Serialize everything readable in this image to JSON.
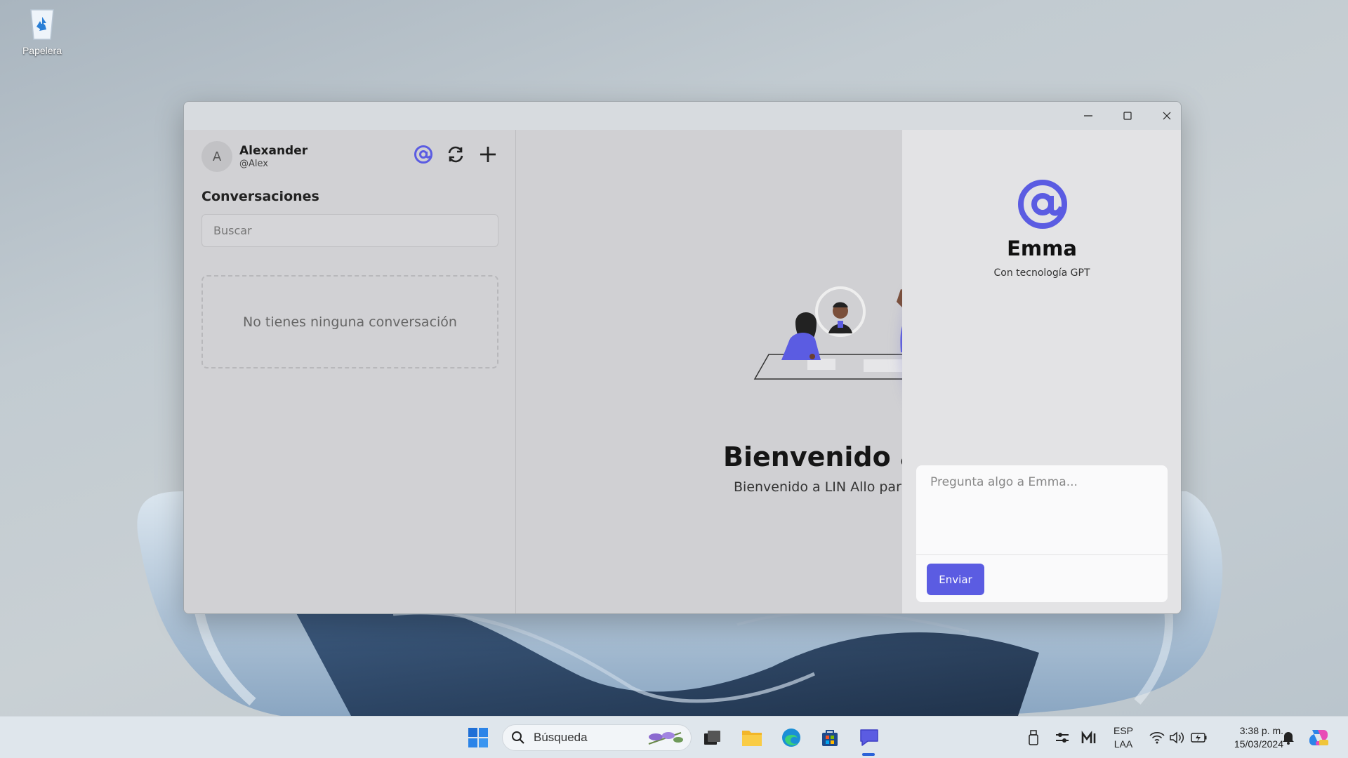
{
  "desktop": {
    "recycle_bin_label": "Papelera"
  },
  "window": {
    "controls": {
      "minimize": "minimize",
      "maximize": "maximize",
      "close": "close"
    }
  },
  "sidebar": {
    "avatar_initial": "A",
    "user_name": "Alexander",
    "user_handle": "@Alex",
    "icons": [
      "at-icon",
      "refresh-icon",
      "plus-icon"
    ],
    "section_title": "Conversaciones",
    "search_placeholder": "Buscar",
    "empty_message": "No tienes ninguna conversación"
  },
  "main": {
    "welcome_title": "Bienvenido a L",
    "welcome_subtitle": "Bienvenido a LIN Allo para"
  },
  "emma_panel": {
    "name": "Emma",
    "subtitle": "Con tecnología GPT",
    "input_placeholder": "Pregunta algo a Emma...",
    "send_label": "Enviar",
    "accent_color": "#5b5ce2"
  },
  "taskbar": {
    "search_placeholder": "Búsqueda",
    "language": "ESP",
    "layout": "LAA",
    "time": "3:38 p. m.",
    "date": "15/03/2024"
  }
}
